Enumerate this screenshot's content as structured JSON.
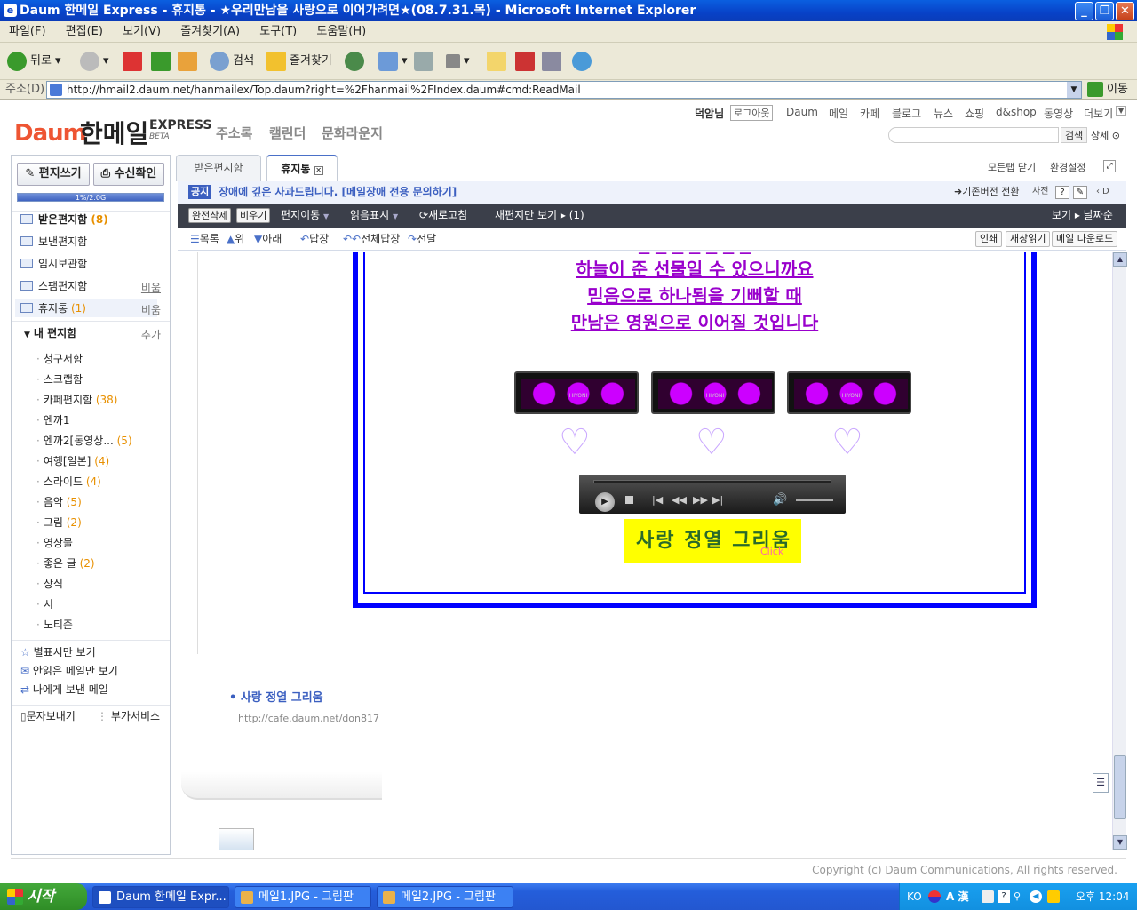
{
  "window": {
    "title": "Daum 한메일 Express - 휴지통 - ★우리만남을 사랑으로 이어가려면★(08.7.31.목) - Microsoft Internet Explorer"
  },
  "menu": [
    "파일(F)",
    "편집(E)",
    "보기(V)",
    "즐겨찾기(A)",
    "도구(T)",
    "도움말(H)"
  ],
  "toolbar": {
    "back": "뒤로",
    "search": "검색",
    "favorites": "즐겨찾기"
  },
  "address": {
    "label": "주소(D)",
    "url": "http://hmail2.daum.net/hanmailex/Top.daum?right=%2Fhanmail%2FIndex.daum#cmd:ReadMail",
    "go": "이동"
  },
  "daum": {
    "logo": "Daum",
    "product": "한메일",
    "express": "EXPRESS",
    "beta": "BETA",
    "links": [
      "주소록",
      "캘린더",
      "문화라운지"
    ],
    "user": "덕암님",
    "logout": "로그아웃",
    "topnav": [
      "Daum",
      "메일",
      "카페",
      "블로그",
      "뉴스",
      "쇼핑",
      "d&shop",
      "동영상",
      "더보기"
    ],
    "search_btn": "검색",
    "detail_btn": "상세"
  },
  "sidebar": {
    "compose": "편지쓰기",
    "receipt": "수신확인",
    "quota": "1%/2.0G",
    "folders": [
      {
        "label": "받은편지함",
        "count": "(8)"
      },
      {
        "label": "보낸편지함",
        "count": ""
      },
      {
        "label": "임시보관함",
        "count": ""
      },
      {
        "label": "스팸편지함",
        "count": "",
        "action": "비움"
      },
      {
        "label": "휴지통",
        "count": "(1)",
        "action": "비움"
      }
    ],
    "my_folders_title": "내 편지함",
    "my_folders_add": "추가",
    "my_folders": [
      {
        "label": "청구서함",
        "count": ""
      },
      {
        "label": "스크랩함",
        "count": ""
      },
      {
        "label": "카페편지함",
        "count": "(38)"
      },
      {
        "label": "엔까1",
        "count": ""
      },
      {
        "label": "엔까2[동영상...",
        "count": "(5)"
      },
      {
        "label": "여행[일본]",
        "count": "(4)"
      },
      {
        "label": "스라이드",
        "count": "(4)"
      },
      {
        "label": "음악",
        "count": "(5)"
      },
      {
        "label": "그림",
        "count": "(2)"
      },
      {
        "label": "영상물",
        "count": ""
      },
      {
        "label": "좋은 글",
        "count": "(2)"
      },
      {
        "label": "상식",
        "count": ""
      },
      {
        "label": "시",
        "count": ""
      },
      {
        "label": "노티즌",
        "count": ""
      }
    ],
    "extras": [
      "별표시만 보기",
      "안읽은 메일만 보기",
      "나에게 보낸 메일"
    ],
    "sms": "문자보내기",
    "addon": "부가서비스"
  },
  "tabs": {
    "inbox": "받은편지함",
    "trash": "휴지통",
    "close_all": "모든탭 닫기",
    "settings": "환경설정"
  },
  "notice": {
    "badge": "공지",
    "text": "장애에 깊은 사과드립니다. [메일장애 전용 문의하기]",
    "switch": "기존버전 전환",
    "dict": "사전",
    "help": "?",
    "id": "ID"
  },
  "actions": {
    "delete_all": "완전삭제",
    "empty": "비우기",
    "move": "편지이동",
    "read_mark": "읽음표시",
    "refresh": "새로고침",
    "new_only": "새편지만 보기",
    "new_count": "(1)",
    "view": "보기",
    "sort": "날짜순"
  },
  "nav": {
    "list": "목록",
    "up": "위",
    "down": "아래",
    "reply": "답장",
    "reply_all": "전체답장",
    "forward": "전달",
    "print": "인쇄",
    "new_window": "새창읽기",
    "download": "메일 다운로드"
  },
  "mail": {
    "lines": [
      "하늘이 준 선물일 수 있으니까요",
      "믿음으로 하나됨을 기뻐할 때",
      "만남은 영원으로 이어질 것입니다"
    ],
    "banner_text": "HIYONI",
    "banner2": "사랑 정열 그리움",
    "banner2_click": "Click",
    "link_title": "사랑 정열 그리움",
    "link_url": "http://cafe.daum.net/don817"
  },
  "footer": "Copyright (c) Daum Communications, All rights reserved.",
  "taskbar": {
    "start": "시작",
    "tasks": [
      "Daum 한메일 Expr...",
      "메일1.JPG - 그림판",
      "메일2.JPG - 그림판"
    ],
    "lang": "KO",
    "time": "오후 12:04"
  },
  "colors": {
    "mail_text": "#9900cc",
    "mail_border": "#0000ff",
    "accent": "#3b5fc0"
  }
}
